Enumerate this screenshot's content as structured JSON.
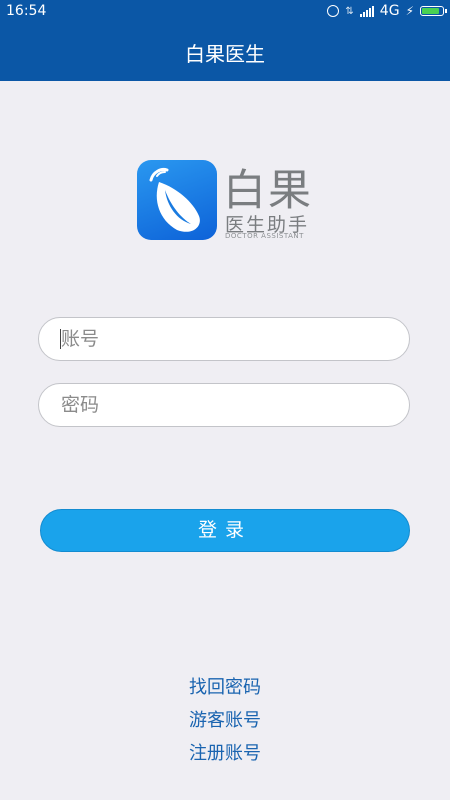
{
  "status_bar": {
    "time": "16:54",
    "network": "4G",
    "battery_level": 0.75,
    "icons": [
      "alarm-icon",
      "data-transfer-icon",
      "signal-icon",
      "charging-icon",
      "battery-icon"
    ]
  },
  "header": {
    "title": "白果医生"
  },
  "logo": {
    "name": "白果",
    "subtitle": "医生助手",
    "english": "DOCTOR ASSISTANT"
  },
  "form": {
    "account_placeholder": "账号",
    "password_placeholder": "密码",
    "login_label": "登录"
  },
  "links": {
    "forgot_password": "找回密码",
    "guest_account": "游客账号",
    "register_account": "注册账号"
  },
  "colors": {
    "header_bg": "#0b57a6",
    "page_bg": "#efeef3",
    "button_bg": "#1aa3eb",
    "link": "#1a64b0"
  }
}
